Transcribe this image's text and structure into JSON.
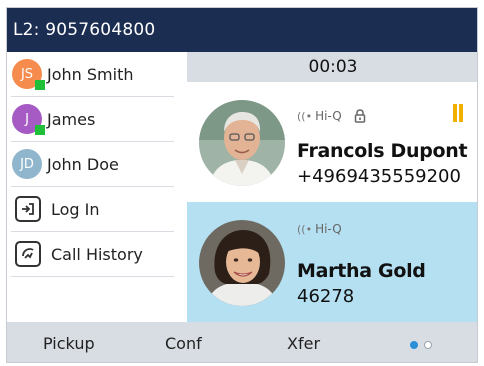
{
  "header": {
    "line_label": "L2: 9057604800"
  },
  "sidebar": {
    "items": [
      {
        "type": "contact",
        "initials": "JS",
        "name": "John Smith",
        "avatar_color": "#f58b4c",
        "presence": "available"
      },
      {
        "type": "contact",
        "initials": "J",
        "name": "James",
        "avatar_color": "#a55bc3",
        "presence": "available"
      },
      {
        "type": "contact",
        "initials": "JD",
        "name": "John Doe",
        "avatar_color": "#8fb6cc",
        "presence": "none"
      },
      {
        "type": "action",
        "label": "Log In",
        "icon": "login-icon"
      },
      {
        "type": "action",
        "label": "Call History",
        "icon": "call-history-icon"
      }
    ]
  },
  "call_timer": "00:03",
  "calls": [
    {
      "hd_label": "Hi-Q",
      "name": "Francols Dupont",
      "number": "+4969435559200",
      "secure": true,
      "state": "held",
      "highlighted": false
    },
    {
      "hd_label": "Hi-Q",
      "name": "Martha Gold",
      "number": "46278",
      "secure": false,
      "state": "active",
      "highlighted": true
    }
  ],
  "softkeys": [
    "Pickup",
    "Conf",
    "Xfer"
  ],
  "page_indicator": {
    "pages": 2,
    "current": 1
  },
  "colors": {
    "header_bg": "#1c2d52",
    "highlight_bg": "#b4e0f2",
    "softkey_bg": "#d8dde3",
    "presence_green": "#1fbf3a",
    "hold_yellow": "#f1b000",
    "page_dot_active": "#2b8fd6"
  }
}
